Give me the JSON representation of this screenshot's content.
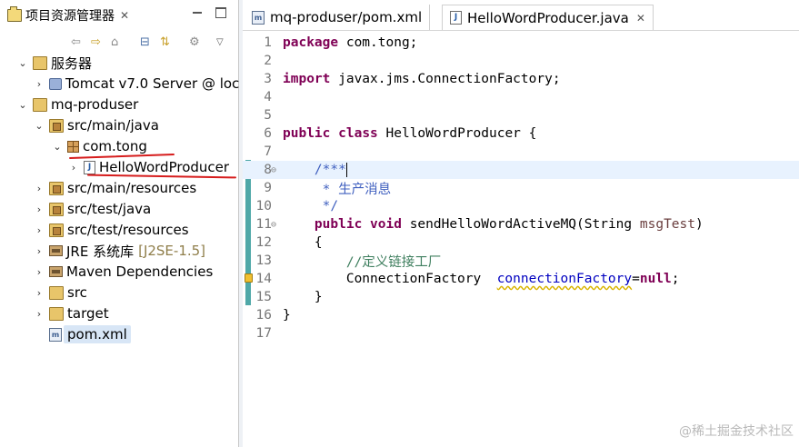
{
  "explorer": {
    "title": "项目资源管理器",
    "close_glyph": "✕",
    "toolbar_icons": [
      "back-icon",
      "forward-icon",
      "home-icon",
      "collapse-all-icon",
      "link-editor-icon",
      "filter-icon",
      "view-menu-icon"
    ],
    "tree": [
      {
        "label": "服务器",
        "twisty": "⌄",
        "icon": "folder-icon"
      },
      {
        "label": "Tomcat v7.0 Server @ loc",
        "twisty": "›",
        "icon": "server-icon"
      },
      {
        "label": "mq-produser",
        "twisty": "⌄",
        "icon": "project-folder-icon"
      },
      {
        "label": "src/main/java",
        "twisty": "⌄",
        "icon": "source-folder-icon"
      },
      {
        "label": "com.tong",
        "twisty": "⌄",
        "icon": "package-icon"
      },
      {
        "label": "HelloWordProducer",
        "twisty": "›",
        "icon": "java-file-icon"
      },
      {
        "label": "src/main/resources",
        "twisty": "›",
        "icon": "source-folder-icon"
      },
      {
        "label": "src/test/java",
        "twisty": "›",
        "icon": "source-folder-icon"
      },
      {
        "label": "src/test/resources",
        "twisty": "›",
        "icon": "source-folder-icon"
      },
      {
        "label": "JRE 系统库",
        "suffix": "[J2SE-1.5]",
        "twisty": "›",
        "icon": "library-icon"
      },
      {
        "label": "Maven Dependencies",
        "twisty": "›",
        "icon": "library-icon"
      },
      {
        "label": "src",
        "twisty": "›",
        "icon": "folder-icon"
      },
      {
        "label": "target",
        "twisty": "›",
        "icon": "folder-icon"
      },
      {
        "label": "pom.xml",
        "twisty": "",
        "icon": "maven-pom-icon"
      }
    ],
    "annotation_color": "#d61c1c"
  },
  "editor": {
    "tabs": [
      {
        "label": "mq-produser/pom.xml",
        "icon": "maven-pom-icon",
        "active": false
      },
      {
        "label": "HelloWordProducer.java",
        "icon": "java-file-icon",
        "active": true,
        "close": "✕"
      }
    ],
    "line_numbers": [
      "1",
      "2",
      "3",
      "4",
      "5",
      "6",
      "7",
      "8",
      "9",
      "10",
      "11",
      "12",
      "13",
      "14",
      "15",
      "16",
      "17"
    ],
    "code": {
      "l1_kw": "package",
      "l1_rest": " com.tong;",
      "l3_kw": "import",
      "l3_rest": " javax.jms.ConnectionFactory;",
      "l6_kw1": "public",
      "l6_kw2": "class",
      "l6_rest": " HelloWordProducer {",
      "l8": "    /***",
      "l9": "     * 生产消息",
      "l10": "     */",
      "l11_kw1": "public",
      "l11_kw2": "void",
      "l11_rest": " sendHelloWordActiveMQ(String ",
      "l11_param": "msgTest",
      "l11_end": ")",
      "l12": "    {",
      "l13": "        //定义链接工厂",
      "l14_type": "        ConnectionFactory  ",
      "l14_field": "connectionFactory",
      "l14_eq": "=",
      "l14_kw": "null",
      "l14_end": ";",
      "l15": "    }",
      "l16": "}"
    },
    "fold_glyph": "⊖",
    "colors": {
      "keyword": "#7f0055",
      "comment": "#3f7f5f",
      "javadoc": "#3f5fbf",
      "field": "#0000c0",
      "current_line": "#e8f2fe",
      "change_bar": "#4fa8a8"
    }
  },
  "watermark": "@稀土掘金技术社区"
}
